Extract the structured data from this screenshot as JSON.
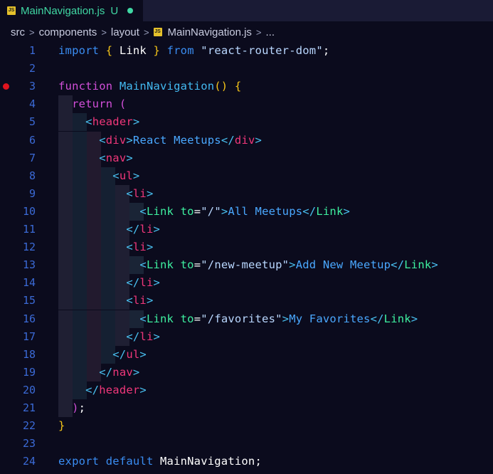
{
  "tab": {
    "filename": "MainNavigation.js",
    "status": "U",
    "badge": "JS"
  },
  "breadcrumb": {
    "items": [
      "src",
      "components",
      "layout",
      "MainNavigation.js",
      "..."
    ],
    "separator": ">"
  },
  "editor": {
    "breakpoint_line": 3,
    "lines": [
      {
        "n": "1"
      },
      {
        "n": "2"
      },
      {
        "n": "3"
      },
      {
        "n": "4"
      },
      {
        "n": "5"
      },
      {
        "n": "6"
      },
      {
        "n": "7"
      },
      {
        "n": "8"
      },
      {
        "n": "9"
      },
      {
        "n": "10"
      },
      {
        "n": "11"
      },
      {
        "n": "12"
      },
      {
        "n": "13"
      },
      {
        "n": "14"
      },
      {
        "n": "15"
      },
      {
        "n": "16"
      },
      {
        "n": "17"
      },
      {
        "n": "18"
      },
      {
        "n": "19"
      },
      {
        "n": "20"
      },
      {
        "n": "21"
      },
      {
        "n": "22"
      },
      {
        "n": "23"
      },
      {
        "n": "24"
      }
    ],
    "code": {
      "l1": [
        [
          "kw-blue",
          "import"
        ],
        [
          "white",
          " "
        ],
        [
          "yellow",
          "{"
        ],
        [
          "white",
          " Link "
        ],
        [
          "yellow",
          "}"
        ],
        [
          "white",
          " "
        ],
        [
          "kw-blue",
          "from"
        ],
        [
          "white",
          " "
        ],
        [
          "str",
          "\"react-router-dom\""
        ],
        [
          "white",
          ";"
        ]
      ],
      "l3": [
        [
          "kw-purple",
          "function"
        ],
        [
          "white",
          " "
        ],
        [
          "fn",
          "MainNavigation"
        ],
        [
          "yellow",
          "()"
        ],
        [
          "white",
          " "
        ],
        [
          "yellow",
          "{"
        ]
      ],
      "l4": [
        [
          "white",
          "  "
        ],
        [
          "kw-purple",
          "return"
        ],
        [
          "white",
          " "
        ],
        [
          "punct",
          "("
        ]
      ],
      "l5": [
        [
          "white",
          "    "
        ],
        [
          "bracket",
          "<"
        ],
        [
          "tag-red",
          "header"
        ],
        [
          "bracket",
          ">"
        ]
      ],
      "l6": [
        [
          "white",
          "      "
        ],
        [
          "bracket",
          "<"
        ],
        [
          "tag-red",
          "div"
        ],
        [
          "bracket",
          ">"
        ],
        [
          "text",
          "React Meetups"
        ],
        [
          "bracket",
          "</"
        ],
        [
          "tag-red",
          "div"
        ],
        [
          "bracket",
          ">"
        ]
      ],
      "l7": [
        [
          "white",
          "      "
        ],
        [
          "bracket",
          "<"
        ],
        [
          "tag-red",
          "nav"
        ],
        [
          "bracket",
          ">"
        ]
      ],
      "l8": [
        [
          "white",
          "        "
        ],
        [
          "bracket",
          "<"
        ],
        [
          "tag-red",
          "ul"
        ],
        [
          "bracket",
          ">"
        ]
      ],
      "l9": [
        [
          "white",
          "          "
        ],
        [
          "bracket",
          "<"
        ],
        [
          "tag-red",
          "li"
        ],
        [
          "bracket",
          ">"
        ]
      ],
      "l10": [
        [
          "white",
          "            "
        ],
        [
          "bracket",
          "<"
        ],
        [
          "comp",
          "Link"
        ],
        [
          "white",
          " "
        ],
        [
          "attr",
          "to"
        ],
        [
          "white",
          "="
        ],
        [
          "str",
          "\"/\""
        ],
        [
          "bracket",
          ">"
        ],
        [
          "text",
          "All Meetups"
        ],
        [
          "bracket",
          "</"
        ],
        [
          "comp",
          "Link"
        ],
        [
          "bracket",
          ">"
        ]
      ],
      "l11": [
        [
          "white",
          "          "
        ],
        [
          "bracket",
          "</"
        ],
        [
          "tag-red",
          "li"
        ],
        [
          "bracket",
          ">"
        ]
      ],
      "l12": [
        [
          "white",
          "          "
        ],
        [
          "bracket",
          "<"
        ],
        [
          "tag-red",
          "li"
        ],
        [
          "bracket",
          ">"
        ]
      ],
      "l13": [
        [
          "white",
          "            "
        ],
        [
          "bracket",
          "<"
        ],
        [
          "comp",
          "Link"
        ],
        [
          "white",
          " "
        ],
        [
          "attr",
          "to"
        ],
        [
          "white",
          "="
        ],
        [
          "str",
          "\"/new-meetup\""
        ],
        [
          "bracket",
          ">"
        ],
        [
          "text",
          "Add New Meetup"
        ],
        [
          "bracket",
          "</"
        ],
        [
          "comp",
          "Link"
        ],
        [
          "bracket",
          ">"
        ]
      ],
      "l14": [
        [
          "white",
          "          "
        ],
        [
          "bracket",
          "</"
        ],
        [
          "tag-red",
          "li"
        ],
        [
          "bracket",
          ">"
        ]
      ],
      "l15": [
        [
          "white",
          "          "
        ],
        [
          "bracket",
          "<"
        ],
        [
          "tag-red",
          "li"
        ],
        [
          "bracket",
          ">"
        ]
      ],
      "l16": [
        [
          "white",
          "            "
        ],
        [
          "bracket",
          "<"
        ],
        [
          "comp",
          "Link"
        ],
        [
          "white",
          " "
        ],
        [
          "attr",
          "to"
        ],
        [
          "white",
          "="
        ],
        [
          "str",
          "\"/favorites\""
        ],
        [
          "bracket",
          ">"
        ],
        [
          "text",
          "My Favorites"
        ],
        [
          "bracket",
          "</"
        ],
        [
          "comp",
          "Link"
        ],
        [
          "bracket",
          ">"
        ]
      ],
      "l17": [
        [
          "white",
          "          "
        ],
        [
          "bracket",
          "</"
        ],
        [
          "tag-red",
          "li"
        ],
        [
          "bracket",
          ">"
        ]
      ],
      "l18": [
        [
          "white",
          "        "
        ],
        [
          "bracket",
          "</"
        ],
        [
          "tag-red",
          "ul"
        ],
        [
          "bracket",
          ">"
        ]
      ],
      "l19": [
        [
          "white",
          "      "
        ],
        [
          "bracket",
          "</"
        ],
        [
          "tag-red",
          "nav"
        ],
        [
          "bracket",
          ">"
        ]
      ],
      "l20": [
        [
          "white",
          "    "
        ],
        [
          "bracket",
          "</"
        ],
        [
          "tag-red",
          "header"
        ],
        [
          "bracket",
          ">"
        ]
      ],
      "l21": [
        [
          "white",
          "  "
        ],
        [
          "punct",
          ")"
        ],
        [
          "white",
          ";"
        ]
      ],
      "l22": [
        [
          "yellow",
          "}"
        ]
      ],
      "l24": [
        [
          "kw-blue",
          "export"
        ],
        [
          "white",
          " "
        ],
        [
          "kw-blue",
          "default"
        ],
        [
          "white",
          " MainNavigation;"
        ]
      ]
    }
  },
  "colors": {
    "background": "#0b0b1d",
    "tabbar": "#1a1b35",
    "line_number": "#3b6ad6",
    "modified": "#40d8a4",
    "breakpoint": "#e0141e"
  }
}
